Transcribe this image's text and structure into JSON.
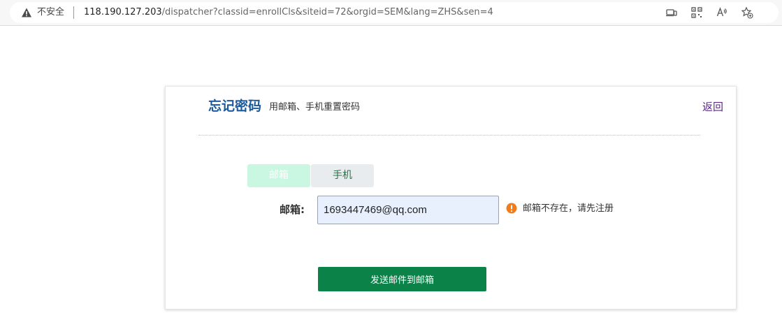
{
  "browser": {
    "security_label": "不安全",
    "url_host": "118.190.127.203",
    "url_path": "/dispatcher?classid=enrollCls&siteid=72&orgid=SEM&lang=ZHS&sen=4",
    "icons": [
      "warning-triangle-icon",
      "device-icon",
      "qr-code-icon",
      "read-aloud-icon",
      "favorites-star-icon"
    ]
  },
  "page": {
    "title": "忘记密码",
    "subtitle": "用邮箱、手机重置密码",
    "back_label": "返回"
  },
  "tabs": [
    {
      "label": "邮箱",
      "active": true
    },
    {
      "label": "手机",
      "active": false
    }
  ],
  "form": {
    "email_label": "邮箱:",
    "email_value": "1693447469@qq.com",
    "error_message": "邮箱不存在，请先注册",
    "submit_label": "发送邮件到邮箱"
  },
  "colors": {
    "title": "#1c5a9c",
    "submit_bg": "#0b8248",
    "active_tab_bg": "#c9f7e2",
    "inactive_tab_bg": "#e9ecef",
    "error_icon": "#f07c1e",
    "back_link": "#5b2a86"
  }
}
